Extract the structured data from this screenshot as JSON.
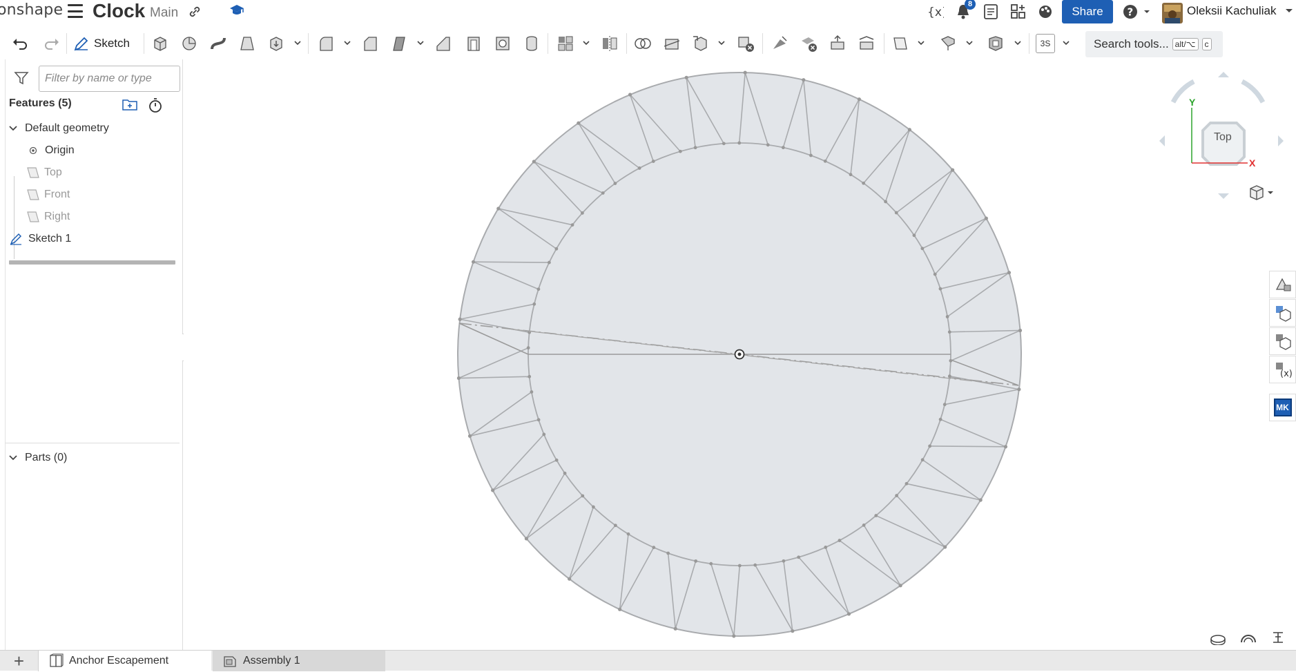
{
  "app": {
    "logo": "onshape",
    "doc_title": "Clock",
    "branch": "Main"
  },
  "top_right": {
    "notifications_count": "8",
    "share_label": "Share",
    "user_name": "Oleksii Kachuliak"
  },
  "toolbar": {
    "sketch_label": "Sketch",
    "view_mode": "3S",
    "search_label": "Search tools...",
    "search_shortcut_1": "alt/⌥",
    "search_shortcut_2": "c"
  },
  "feature_panel": {
    "filter_placeholder": "Filter by name or type",
    "features_header": "Features (5)",
    "default_geometry": "Default geometry",
    "origin": "Origin",
    "plane_top": "Top",
    "plane_front": "Front",
    "plane_right": "Right",
    "sketch": "Sketch 1",
    "parts_header": "Parts (0)"
  },
  "viewcube": {
    "face_label": "Top",
    "axis_y": "Y",
    "axis_x": "X"
  },
  "tabs": [
    {
      "label": "Anchor Escapement",
      "active": true
    },
    {
      "label": "Assembly 1",
      "active": false
    }
  ],
  "right_stack": {
    "mk_label": "MK"
  },
  "colors": {
    "accent": "#1e5fb4",
    "sketch_fill": "#e2e5e9",
    "sketch_line": "#a9abae",
    "axis_x": "#e13030",
    "axis_y": "#2ba32b"
  }
}
